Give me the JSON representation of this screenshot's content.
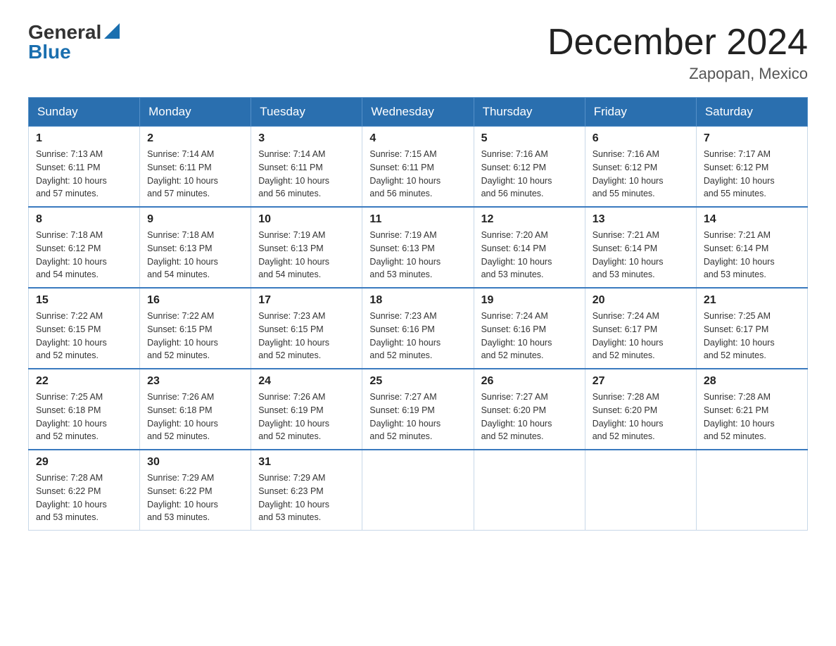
{
  "header": {
    "logo_general": "General",
    "logo_blue": "Blue",
    "month_title": "December 2024",
    "location": "Zapopan, Mexico"
  },
  "weekdays": [
    "Sunday",
    "Monday",
    "Tuesday",
    "Wednesday",
    "Thursday",
    "Friday",
    "Saturday"
  ],
  "weeks": [
    [
      {
        "day": "1",
        "sunrise": "7:13 AM",
        "sunset": "6:11 PM",
        "daylight": "10 hours and 57 minutes."
      },
      {
        "day": "2",
        "sunrise": "7:14 AM",
        "sunset": "6:11 PM",
        "daylight": "10 hours and 57 minutes."
      },
      {
        "day": "3",
        "sunrise": "7:14 AM",
        "sunset": "6:11 PM",
        "daylight": "10 hours and 56 minutes."
      },
      {
        "day": "4",
        "sunrise": "7:15 AM",
        "sunset": "6:11 PM",
        "daylight": "10 hours and 56 minutes."
      },
      {
        "day": "5",
        "sunrise": "7:16 AM",
        "sunset": "6:12 PM",
        "daylight": "10 hours and 56 minutes."
      },
      {
        "day": "6",
        "sunrise": "7:16 AM",
        "sunset": "6:12 PM",
        "daylight": "10 hours and 55 minutes."
      },
      {
        "day": "7",
        "sunrise": "7:17 AM",
        "sunset": "6:12 PM",
        "daylight": "10 hours and 55 minutes."
      }
    ],
    [
      {
        "day": "8",
        "sunrise": "7:18 AM",
        "sunset": "6:12 PM",
        "daylight": "10 hours and 54 minutes."
      },
      {
        "day": "9",
        "sunrise": "7:18 AM",
        "sunset": "6:13 PM",
        "daylight": "10 hours and 54 minutes."
      },
      {
        "day": "10",
        "sunrise": "7:19 AM",
        "sunset": "6:13 PM",
        "daylight": "10 hours and 54 minutes."
      },
      {
        "day": "11",
        "sunrise": "7:19 AM",
        "sunset": "6:13 PM",
        "daylight": "10 hours and 53 minutes."
      },
      {
        "day": "12",
        "sunrise": "7:20 AM",
        "sunset": "6:14 PM",
        "daylight": "10 hours and 53 minutes."
      },
      {
        "day": "13",
        "sunrise": "7:21 AM",
        "sunset": "6:14 PM",
        "daylight": "10 hours and 53 minutes."
      },
      {
        "day": "14",
        "sunrise": "7:21 AM",
        "sunset": "6:14 PM",
        "daylight": "10 hours and 53 minutes."
      }
    ],
    [
      {
        "day": "15",
        "sunrise": "7:22 AM",
        "sunset": "6:15 PM",
        "daylight": "10 hours and 52 minutes."
      },
      {
        "day": "16",
        "sunrise": "7:22 AM",
        "sunset": "6:15 PM",
        "daylight": "10 hours and 52 minutes."
      },
      {
        "day": "17",
        "sunrise": "7:23 AM",
        "sunset": "6:15 PM",
        "daylight": "10 hours and 52 minutes."
      },
      {
        "day": "18",
        "sunrise": "7:23 AM",
        "sunset": "6:16 PM",
        "daylight": "10 hours and 52 minutes."
      },
      {
        "day": "19",
        "sunrise": "7:24 AM",
        "sunset": "6:16 PM",
        "daylight": "10 hours and 52 minutes."
      },
      {
        "day": "20",
        "sunrise": "7:24 AM",
        "sunset": "6:17 PM",
        "daylight": "10 hours and 52 minutes."
      },
      {
        "day": "21",
        "sunrise": "7:25 AM",
        "sunset": "6:17 PM",
        "daylight": "10 hours and 52 minutes."
      }
    ],
    [
      {
        "day": "22",
        "sunrise": "7:25 AM",
        "sunset": "6:18 PM",
        "daylight": "10 hours and 52 minutes."
      },
      {
        "day": "23",
        "sunrise": "7:26 AM",
        "sunset": "6:18 PM",
        "daylight": "10 hours and 52 minutes."
      },
      {
        "day": "24",
        "sunrise": "7:26 AM",
        "sunset": "6:19 PM",
        "daylight": "10 hours and 52 minutes."
      },
      {
        "day": "25",
        "sunrise": "7:27 AM",
        "sunset": "6:19 PM",
        "daylight": "10 hours and 52 minutes."
      },
      {
        "day": "26",
        "sunrise": "7:27 AM",
        "sunset": "6:20 PM",
        "daylight": "10 hours and 52 minutes."
      },
      {
        "day": "27",
        "sunrise": "7:28 AM",
        "sunset": "6:20 PM",
        "daylight": "10 hours and 52 minutes."
      },
      {
        "day": "28",
        "sunrise": "7:28 AM",
        "sunset": "6:21 PM",
        "daylight": "10 hours and 52 minutes."
      }
    ],
    [
      {
        "day": "29",
        "sunrise": "7:28 AM",
        "sunset": "6:22 PM",
        "daylight": "10 hours and 53 minutes."
      },
      {
        "day": "30",
        "sunrise": "7:29 AM",
        "sunset": "6:22 PM",
        "daylight": "10 hours and 53 minutes."
      },
      {
        "day": "31",
        "sunrise": "7:29 AM",
        "sunset": "6:23 PM",
        "daylight": "10 hours and 53 minutes."
      },
      null,
      null,
      null,
      null
    ]
  ],
  "labels": {
    "sunrise": "Sunrise:",
    "sunset": "Sunset:",
    "daylight": "Daylight:"
  }
}
